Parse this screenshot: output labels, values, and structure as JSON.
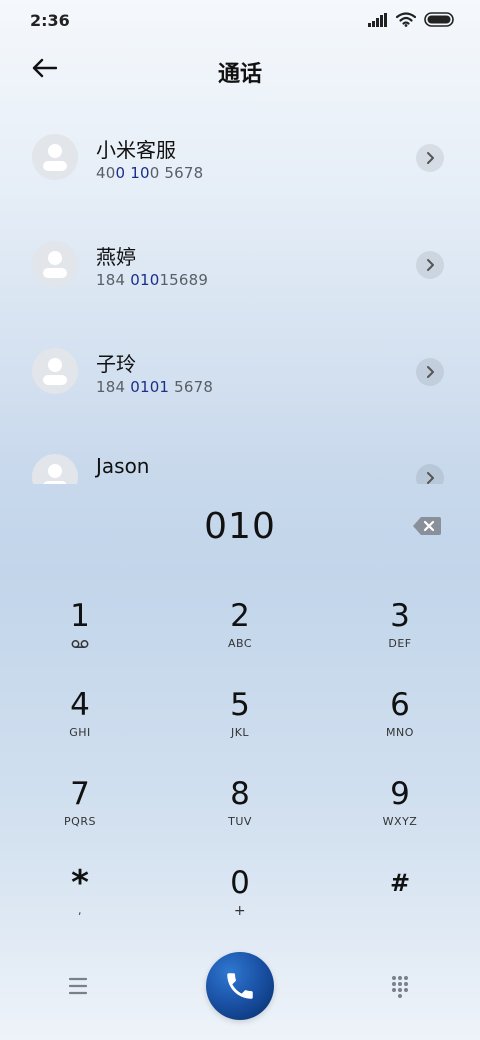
{
  "status_bar": {
    "time": "2:36"
  },
  "header": {
    "title": "通话"
  },
  "contacts": [
    {
      "name": "小米客服",
      "number_parts": [
        "40",
        "0",
        " ",
        "10",
        "0 5678"
      ]
    },
    {
      "name": "燕婷",
      "number_parts": [
        "184 ",
        "010",
        "15689"
      ]
    },
    {
      "name": "子玲",
      "number_parts": [
        "184 ",
        "0101",
        " 5678"
      ]
    },
    {
      "name": "Jason",
      "number_parts": []
    }
  ],
  "dial": {
    "number": "010"
  },
  "keypad": [
    {
      "digit": "1",
      "letters": ""
    },
    {
      "digit": "2",
      "letters": "ABC"
    },
    {
      "digit": "3",
      "letters": "DEF"
    },
    {
      "digit": "4",
      "letters": "GHI"
    },
    {
      "digit": "5",
      "letters": "JKL"
    },
    {
      "digit": "6",
      "letters": "MNO"
    },
    {
      "digit": "7",
      "letters": "PQRS"
    },
    {
      "digit": "8",
      "letters": "TUV"
    },
    {
      "digit": "9",
      "letters": "WXYZ"
    },
    {
      "digit": "*",
      "letters": ","
    },
    {
      "digit": "0",
      "letters": "+"
    },
    {
      "digit": "#",
      "letters": ""
    }
  ],
  "icons": {
    "back": "back-arrow-icon",
    "delete": "backspace-icon",
    "voicemail": "voicemail-icon",
    "menu": "menu-icon",
    "call": "phone-icon",
    "keypad": "dialpad-icon"
  },
  "colors": {
    "match_highlight": "#1a2f8a",
    "call_button": "#1b54a8"
  }
}
